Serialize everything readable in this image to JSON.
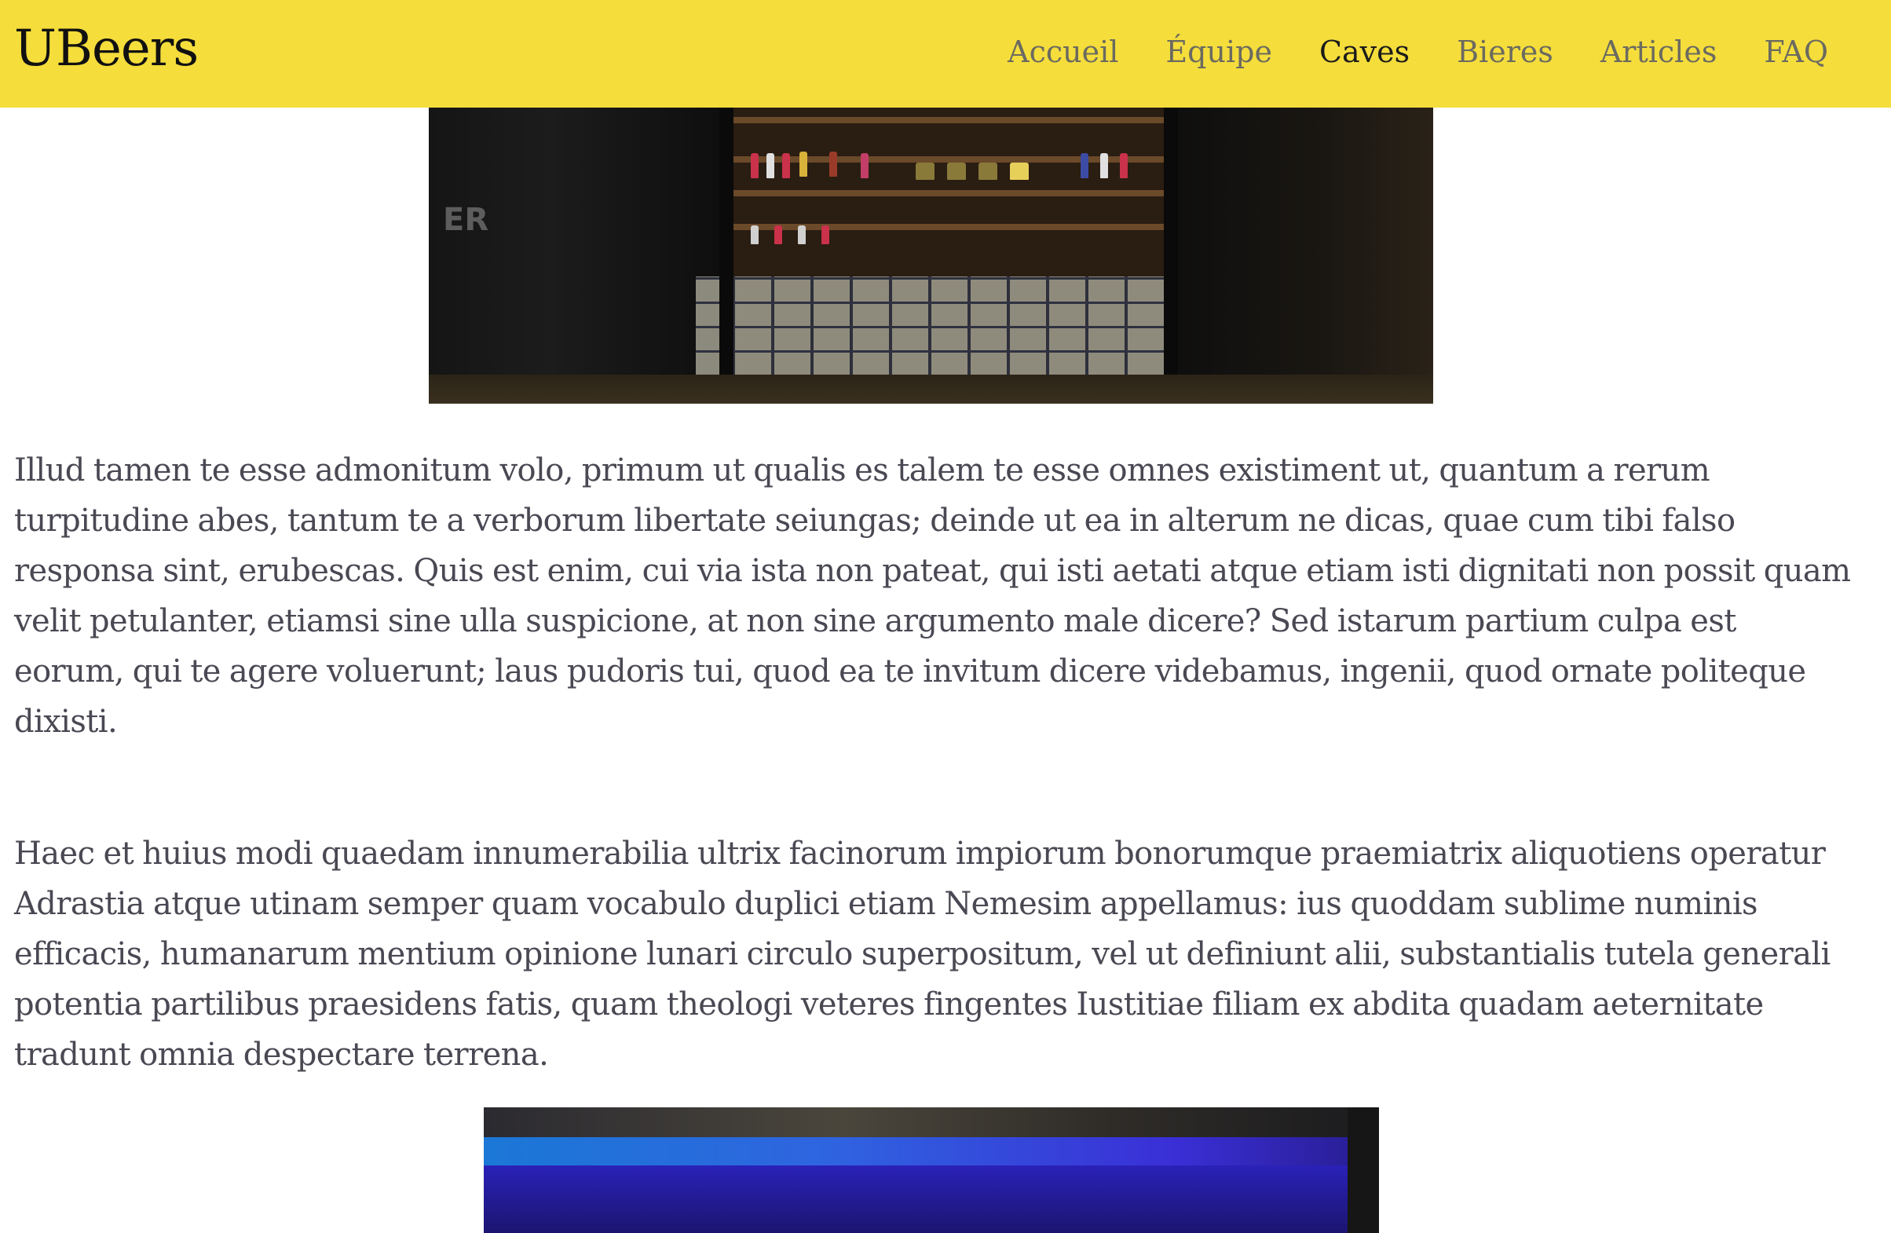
{
  "header": {
    "brand": "UBeers",
    "nav": [
      {
        "label": "Accueil",
        "active": false
      },
      {
        "label": "Équipe",
        "active": false
      },
      {
        "label": "Caves",
        "active": true
      },
      {
        "label": "Bieres",
        "active": false
      },
      {
        "label": "Articles",
        "active": false
      },
      {
        "label": "FAQ",
        "active": false
      }
    ]
  },
  "colors": {
    "header_bg": "#f5dd3b",
    "text": "#4a4853",
    "nav_text": "#6b6a60",
    "nav_active": "#1b1b1b"
  },
  "main": {
    "paragraphs": [
      "Illud tamen te esse admonitum volo, primum ut qualis es talem te esse omnes existiment ut, quantum a rerum turpitudine abes, tantum te a verborum libertate seiungas; deinde ut ea in alterum ne dicas, quae cum tibi falso responsa sint, erubescas. Quis est enim, cui via ista non pateat, qui isti aetati atque etiam isti dignitati non possit quam velit petulanter, etiamsi sine ulla suspicione, at non sine argumento male dicere? Sed istarum partium culpa est eorum, qui te agere voluerunt; laus pudoris tui, quod ea te invitum dicere videbamus, ingenii, quod ornate politeque dixisti.",
      "Haec et huius modi quaedam innumerabilia ultrix facinorum impiorum bonorumque praemiatrix aliquotiens operatur Adrastia atque utinam semper quam vocabulo duplici etiam Nemesim appellamus: ius quoddam sublime numinis efficacis, humanarum mentium opinione lunari circulo superpositum, vel ut definiunt alii, substantialis tutela generali potentia partilibus praesidens fatis, quam theologi veteres fingentes Iustitiae filiam ex abdita quadam aeternitate tradunt omnia despectare terrena."
    ]
  }
}
